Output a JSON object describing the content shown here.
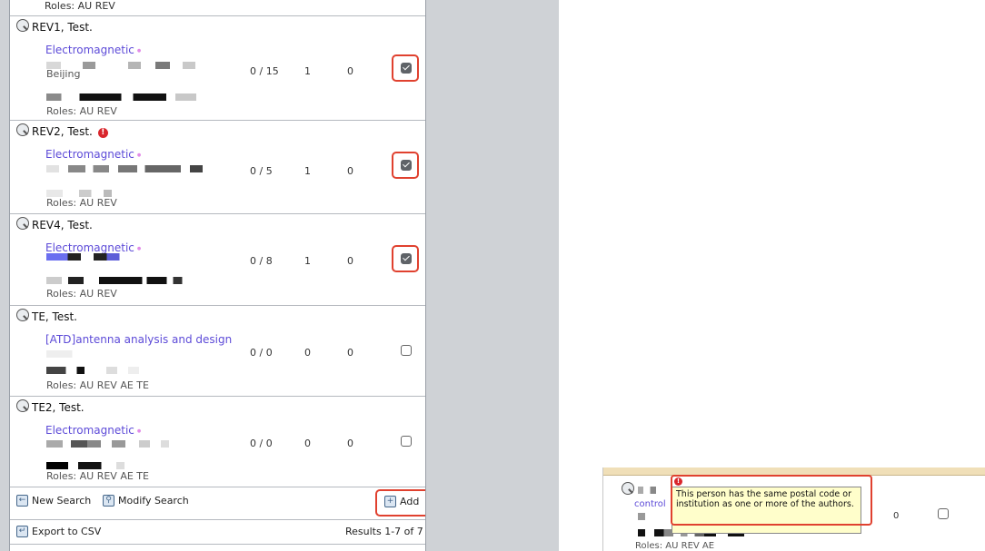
{
  "top_truncated_roles": "Roles: AU REV",
  "reviewers": [
    {
      "name": "REV1, Test.",
      "keyword": "Electromagnetic",
      "city": "Beijing",
      "stats": [
        "0 / 15",
        "1",
        "0"
      ],
      "roles": "Roles: AU REV",
      "checked": true,
      "highlighted": true,
      "alert": false
    },
    {
      "name": "REV2, Test.",
      "keyword": "Electromagnetic",
      "city": "",
      "stats": [
        "0 / 5",
        "1",
        "0"
      ],
      "roles": "Roles: AU REV",
      "checked": true,
      "highlighted": true,
      "alert": true
    },
    {
      "name": "REV4, Test.",
      "keyword": "Electromagnetic",
      "city": "",
      "stats": [
        "0 / 8",
        "1",
        "0"
      ],
      "roles": "Roles: AU REV",
      "checked": true,
      "highlighted": true,
      "alert": false
    },
    {
      "name": "TE, Test.",
      "keyword": "[ATD]antenna analysis and design",
      "city": "",
      "stats": [
        "0 / 0",
        "0",
        "0"
      ],
      "roles": "Roles: AU REV AE TE",
      "checked": false,
      "highlighted": false,
      "alert": false
    },
    {
      "name": "TE2, Test.",
      "keyword": "Electromagnetic",
      "city": "",
      "stats": [
        "0 / 0",
        "0",
        "0"
      ],
      "roles": "Roles: AU REV AE TE",
      "checked": false,
      "highlighted": false,
      "alert": false
    }
  ],
  "footer": {
    "new_search": "New Search",
    "modify_search": "Modify Search",
    "add": "Add",
    "export_csv": "Export to CSV",
    "results_count": "Results 1-7 of 7"
  },
  "popup": {
    "keyword": "control",
    "tooltip": "This person has the same postal code or institution as one or more of the authors.",
    "stat": "0",
    "roles": "Roles: AU REV AE"
  },
  "colors": {
    "highlight": "#e0412f",
    "link": "#5d4bd8",
    "tooltip_bg": "#fffecb"
  },
  "icons": [
    "magnifier-icon",
    "alert-icon",
    "checkbox-icon",
    "new-search-icon",
    "modify-search-icon",
    "add-icon",
    "export-icon"
  ]
}
